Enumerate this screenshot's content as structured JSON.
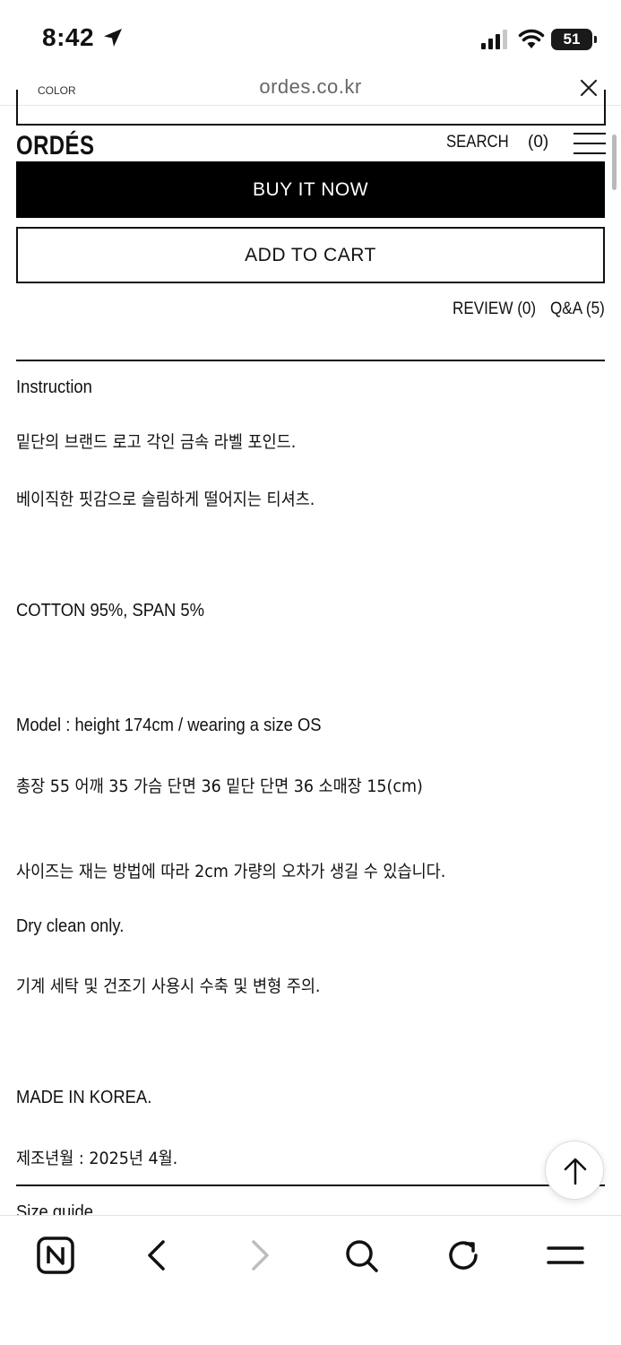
{
  "status": {
    "time": "8:42",
    "battery": "51"
  },
  "browser": {
    "url": "ordes.co.kr"
  },
  "header": {
    "logo": "ORDÉS",
    "search": "SEARCH",
    "cart_count": "(0)"
  },
  "option_select": {
    "label": "COLOR"
  },
  "actions": {
    "buy_now": "BUY IT NOW",
    "add_to_cart": "ADD TO CART"
  },
  "tabs": {
    "review": "REVIEW (0)",
    "qa": "Q&A (5)"
  },
  "instruction": {
    "heading": "Instruction",
    "lines": [
      "밑단의 브랜드 로고 각인 금속 라벨 포인드.",
      "베이직한 핏감으로 슬림하게 떨어지는 티셔츠.",
      "COTTON 95%, SPAN 5%",
      "Model : height 174cm / wearing a size OS",
      "총장 55 어깨 35 가슴 단면 36 밑단 단면 36 소매장 15(cm)",
      "사이즈는 재는 방법에 따라 2cm 가량의 오차가 생길 수 있습니다.",
      "Dry clean only.",
      "기계 세탁 및 건조기 사용시 수축 및 변형 주의.",
      "MADE IN KOREA.",
      "제조년월 : 2025년 4월."
    ]
  },
  "size_guide": {
    "heading": "Size guide"
  },
  "icons": {
    "location": "location-arrow-icon",
    "signal": "signal-icon",
    "wifi": "wifi-icon",
    "close": "close-icon",
    "menu": "hamburger-menu-icon",
    "scroll_top": "arrow-up-icon",
    "naver": "naver-n-icon",
    "back": "chevron-left-icon",
    "forward": "chevron-right-icon",
    "search": "search-icon",
    "refresh": "refresh-icon",
    "more": "menu-icon"
  }
}
